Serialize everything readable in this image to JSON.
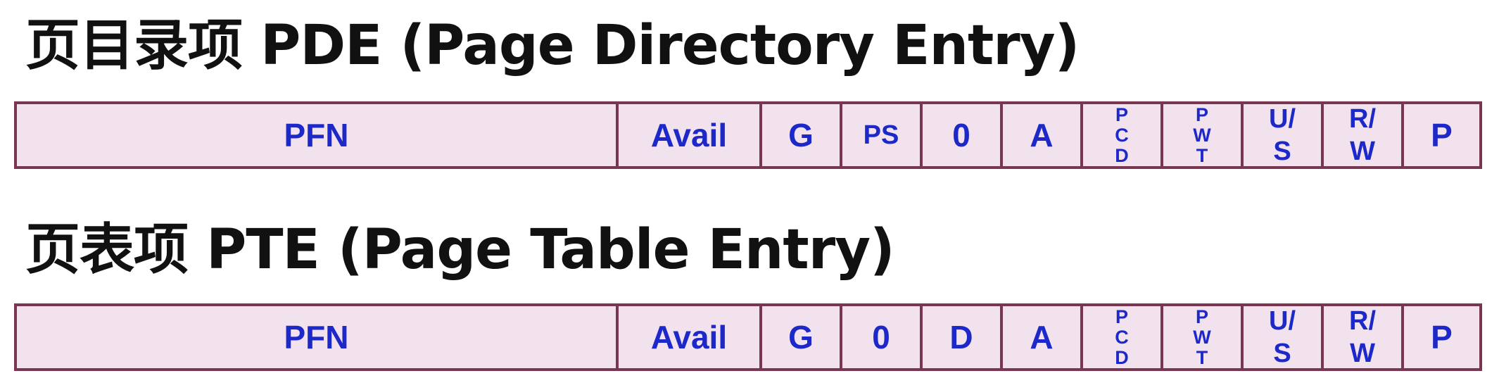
{
  "pde": {
    "title": "页目录项  PDE  (Page Directory Entry)",
    "fields": [
      {
        "label": "PFN"
      },
      {
        "label": "Avail"
      },
      {
        "label": "G"
      },
      {
        "label": "PS"
      },
      {
        "label": "0"
      },
      {
        "label": "A"
      },
      {
        "label": "P\nC\nD"
      },
      {
        "label": "P\nW\nT"
      },
      {
        "label": "U/\nS"
      },
      {
        "label": "R/\nW"
      },
      {
        "label": "P"
      }
    ]
  },
  "pte": {
    "title": "页表项  PTE  (Page Table Entry)",
    "fields": [
      {
        "label": "PFN"
      },
      {
        "label": "Avail"
      },
      {
        "label": "G"
      },
      {
        "label": "0"
      },
      {
        "label": "D"
      },
      {
        "label": "A"
      },
      {
        "label": "P\nC\nD"
      },
      {
        "label": "P\nW\nT"
      },
      {
        "label": "U/\nS"
      },
      {
        "label": "R/\nW"
      },
      {
        "label": "P"
      }
    ]
  },
  "colors": {
    "field_text": "#1d28c8",
    "field_fill": "#f2e2ee",
    "field_border": "#7a3550",
    "title_text": "#111111"
  }
}
